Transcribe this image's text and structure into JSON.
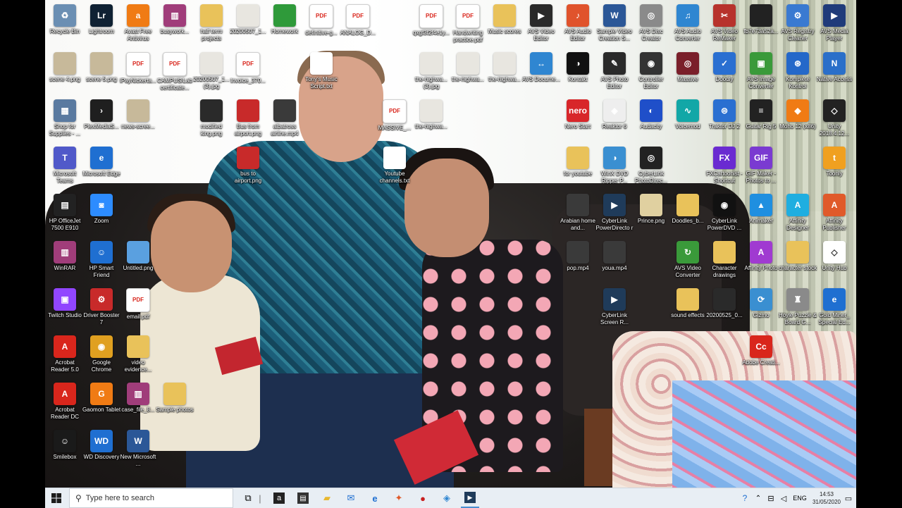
{
  "desktop": {
    "icons": [
      {
        "label": "Recycle Bin",
        "glyph": "♻",
        "color": "#6b8fb3"
      },
      {
        "label": "Lightroom",
        "glyph": "Lr",
        "color": "#0f2133"
      },
      {
        "label": "Avast Free Antivirus",
        "glyph": "a",
        "color": "#f07b14"
      },
      {
        "label": "busywork...",
        "glyph": "▥",
        "color": "#a03d7a"
      },
      {
        "label": "half term projects",
        "glyph": "",
        "color": "#e9c25a"
      },
      {
        "label": "20200507_1...",
        "glyph": "",
        "color": "#e8e6e0"
      },
      {
        "label": "Homework",
        "glyph": "",
        "color": "#2f9a3a"
      },
      {
        "label": "definitive-g...",
        "glyph": "PDF",
        "color": "#ffffff"
      },
      {
        "label": "ANALOG_D...",
        "glyph": "PDF",
        "color": "#ffffff"
      },
      {
        "label": "qxgf3f2f4e1y...",
        "glyph": "PDF",
        "color": "#ffffff"
      },
      {
        "label": "Handwriting practice.pdf",
        "glyph": "PDF",
        "color": "#ffffff"
      },
      {
        "label": "Music scores",
        "glyph": "",
        "color": "#e9c25a"
      },
      {
        "label": "AVS Video Editor",
        "glyph": "▶",
        "color": "#2a2a2a"
      },
      {
        "label": "AVS Audio Editor",
        "glyph": "♪",
        "color": "#e0532c"
      },
      {
        "label": "Sample Video Creation S...",
        "glyph": "W",
        "color": "#2b5797"
      },
      {
        "label": "AVS Disc Creator",
        "glyph": "◎",
        "color": "#8a8a8a"
      },
      {
        "label": "AVS Audio Converter",
        "glyph": "♫",
        "color": "#2f86d1"
      },
      {
        "label": "AVS Video ReMaker",
        "glyph": "✂",
        "color": "#b7322c"
      },
      {
        "label": "fb7e73a52a...",
        "glyph": "",
        "color": "#222222"
      },
      {
        "label": "AVS Registry Cleaner",
        "glyph": "⚙",
        "color": "#3a7ad1"
      },
      {
        "label": "AVS Media Player",
        "glyph": "▶",
        "color": "#1f3b7a"
      },
      {
        "label": "scene 4.png",
        "glyph": "",
        "color": "#c7b99a"
      },
      {
        "label": "scene 5.png",
        "glyph": "",
        "color": "#c7b99a"
      },
      {
        "label": "iPayNickerta...",
        "glyph": "PDF",
        "color": "#ffffff"
      },
      {
        "label": "CAMPUS/Lab certificate...",
        "glyph": "PDF",
        "color": "#ffffff"
      },
      {
        "label": "20200507_1... (3).jpg",
        "glyph": "",
        "color": "#e8e6e0"
      },
      {
        "label": "Invoice_370...",
        "glyph": "PDF",
        "color": "#ffffff"
      },
      {
        "label": "Tony's Music Script.txt",
        "glyph": "",
        "color": "#ffffff"
      },
      {
        "label": "the-highwa... (3).jpg",
        "glyph": "",
        "color": "#e8e6e0"
      },
      {
        "label": "the-highwa...",
        "glyph": "",
        "color": "#e8e6e0"
      },
      {
        "label": "the-highwa...",
        "glyph": "",
        "color": "#e8e6e0"
      },
      {
        "label": "AVS Docume...",
        "glyph": "↔",
        "color": "#2f86d1"
      },
      {
        "label": "Kontakt",
        "glyph": "◑",
        "color": "#111111"
      },
      {
        "label": "AVS Photo Editor",
        "glyph": "✎",
        "color": "#2a2a2a"
      },
      {
        "label": "Controller Editor",
        "glyph": "◉",
        "color": "#333333"
      },
      {
        "label": "Massive",
        "glyph": "◎",
        "color": "#7a1f2a"
      },
      {
        "label": "Doodly",
        "glyph": "✓",
        "color": "#2a6fd1"
      },
      {
        "label": "AVS Image Converter",
        "glyph": "▣",
        "color": "#3a9a3a"
      },
      {
        "label": "Komplete Kontrol",
        "glyph": "⊛",
        "color": "#2468c9"
      },
      {
        "label": "Native Access",
        "glyph": "N",
        "color": "#2a6fc9"
      },
      {
        "label": "Shop for Supplies - ...",
        "glyph": "▦",
        "color": "#5a7aa0"
      },
      {
        "label": "PlexMediaS...",
        "glyph": "›",
        "color": "#1f1f1f"
      },
      {
        "label": "news-scree...",
        "glyph": "",
        "color": "#c7b99a"
      },
      {
        "label": "modified king.png",
        "glyph": "",
        "color": "#2a2a2a"
      },
      {
        "label": "Bus from airport.png",
        "glyph": "",
        "color": "#c82a2a"
      },
      {
        "label": "albatross airline.mp4",
        "glyph": "",
        "color": "#3a3a3a"
      },
      {
        "label": "MASSIVE_...",
        "glyph": "PDF",
        "color": "#ffffff"
      },
      {
        "label": "the-highwa...",
        "glyph": "",
        "color": "#e8e6e0"
      },
      {
        "label": "Nero Start",
        "glyph": "nero",
        "color": "#d8262a"
      },
      {
        "label": "Reaktor 6",
        "glyph": "◈",
        "color": "#eeeeee"
      },
      {
        "label": "Audacity",
        "glyph": "◐",
        "color": "#1f4fc9"
      },
      {
        "label": "Voicemod",
        "glyph": "∿",
        "color": "#12a7a7"
      },
      {
        "label": "Traktor DJ 2",
        "glyph": "⊜",
        "color": "#2a6fd1"
      },
      {
        "label": "Guitar Rig 5",
        "glyph": "≡",
        "color": "#222222"
      },
      {
        "label": "Moho 12 (x86)",
        "glyph": "◆",
        "color": "#f07b14"
      },
      {
        "label": "Unity 2018.4.12...",
        "glyph": "◇",
        "color": "#222222"
      },
      {
        "label": "Microsoft Teams",
        "glyph": "T",
        "color": "#5059c9"
      },
      {
        "label": "Microsoft Edge",
        "glyph": "e",
        "color": "#1f6fd1"
      },
      {
        "label": "bus to airport.png",
        "glyph": "",
        "color": "#c82a2a"
      },
      {
        "label": "Youtube channels.txt",
        "glyph": "",
        "color": "#ffffff"
      },
      {
        "label": "for youtube",
        "glyph": "",
        "color": "#e9c25a"
      },
      {
        "label": "WinX DVD Ripper P...",
        "glyph": "◑",
        "color": "#3a8fd1"
      },
      {
        "label": "CyberLink PhotoDirec...",
        "glyph": "◎",
        "color": "#222222"
      },
      {
        "label": "FXCartoonist - Shortcut",
        "glyph": "FX",
        "color": "#6a2ad1"
      },
      {
        "label": "GIF Maker - Photos to ...",
        "glyph": "GIF",
        "color": "#7a3ad1"
      },
      {
        "label": "Toonly",
        "glyph": "t",
        "color": "#f0a020"
      },
      {
        "label": "HP OfficeJet 7500 E910",
        "glyph": "▤",
        "color": "#222222"
      },
      {
        "label": "Zoom",
        "glyph": "◙",
        "color": "#2d8cff"
      },
      {
        "label": "Arabian home and...",
        "glyph": "",
        "color": "#3a3a3a"
      },
      {
        "label": "CyberLink PowerDirecto r 18",
        "glyph": "▶",
        "color": "#1f3b5a"
      },
      {
        "label": "Prince.png",
        "glyph": "",
        "color": "#e0d0a0"
      },
      {
        "label": "Doodles_b...",
        "glyph": "",
        "color": "#e9c25a"
      },
      {
        "label": "CyberLink PowerDVD ...",
        "glyph": "◉",
        "color": "#111111"
      },
      {
        "label": "Animaker",
        "glyph": "▲",
        "color": "#1f8fe0"
      },
      {
        "label": "Affinity Designer",
        "glyph": "A",
        "color": "#1faee0"
      },
      {
        "label": "Affinity Publisher",
        "glyph": "A",
        "color": "#e05a2a"
      },
      {
        "label": "WinRAR",
        "glyph": "▥",
        "color": "#a03d7a"
      },
      {
        "label": "HP Smart Friend",
        "glyph": "☺",
        "color": "#1f6fd1"
      },
      {
        "label": "Untitled.png",
        "glyph": "",
        "color": "#5aa0e0"
      },
      {
        "label": "pop.mp4",
        "glyph": "",
        "color": "#3a3a3a"
      },
      {
        "label": "youa.mp4",
        "glyph": "",
        "color": "#3a3a3a"
      },
      {
        "label": "AVS Video Converter",
        "glyph": "↻",
        "color": "#3a9a3a"
      },
      {
        "label": "Character drawings",
        "glyph": "",
        "color": "#e9c25a"
      },
      {
        "label": "Affinity Photo",
        "glyph": "A",
        "color": "#a03ad1"
      },
      {
        "label": "character stock",
        "glyph": "",
        "color": "#e9c25a"
      },
      {
        "label": "Unity Hub",
        "glyph": "◇",
        "color": "#ffffff"
      },
      {
        "label": "Twitch Studio",
        "glyph": "▣",
        "color": "#9146ff"
      },
      {
        "label": "Driver Booster 7",
        "glyph": "⚙",
        "color": "#c82a2a"
      },
      {
        "label": "email.pdf",
        "glyph": "PDF",
        "color": "#ffffff"
      },
      {
        "label": "CyberLink Screen R...",
        "glyph": "▶",
        "color": "#1f3b5a"
      },
      {
        "label": "sound effects",
        "glyph": "",
        "color": "#e9c25a"
      },
      {
        "label": "20200525_0...",
        "glyph": "",
        "color": "#2a2a2a"
      },
      {
        "label": "Gizmo",
        "glyph": "⟳",
        "color": "#3a8fd1"
      },
      {
        "label": "Hoyle Puzzle & Board G...",
        "glyph": "♜",
        "color": "#8a8a8a"
      },
      {
        "label": "Gold Miner_ Special Ed...",
        "glyph": "e",
        "color": "#1f6fd1"
      },
      {
        "label": "Acrobat Reader 5.0",
        "glyph": "A",
        "color": "#d9261c"
      },
      {
        "label": "Google Chrome",
        "glyph": "◉",
        "color": "#e0a020"
      },
      {
        "label": "video evidence...",
        "glyph": "",
        "color": "#e9c25a"
      },
      {
        "label": "Adobe Creati...",
        "glyph": "Cc",
        "color": "#d9261c"
      },
      {
        "label": "Acrobat Reader DC",
        "glyph": "A",
        "color": "#d9261c"
      },
      {
        "label": "Gaomon Tablet",
        "glyph": "G",
        "color": "#f07b14"
      },
      {
        "label": "case_file_8...",
        "glyph": "▥",
        "color": "#a03d7a"
      },
      {
        "label": "Sample photos",
        "glyph": "",
        "color": "#e9c25a"
      },
      {
        "label": "Smilebox",
        "glyph": "☺",
        "color": "#1a1a1a"
      },
      {
        "label": "WD Discovery",
        "glyph": "WD",
        "color": "#1f6fd1"
      },
      {
        "label": "New Microsoft ...",
        "glyph": "W",
        "color": "#2b5797"
      }
    ]
  },
  "taskbar": {
    "search_placeholder": "Type here to search",
    "language": "ENG",
    "time": "14:53",
    "date": "31/05/2020"
  }
}
